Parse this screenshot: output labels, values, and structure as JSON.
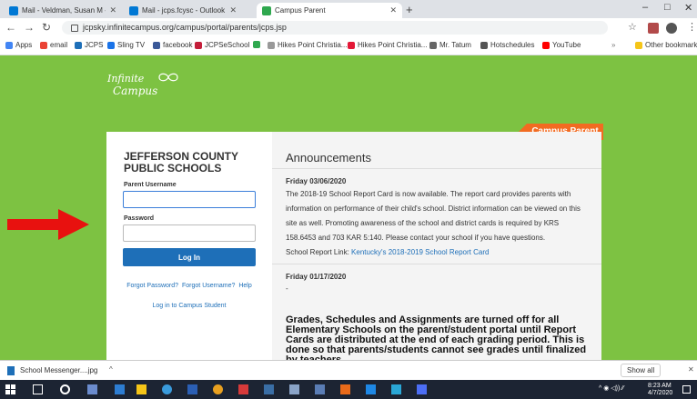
{
  "browser": {
    "tabs": [
      {
        "label": "Mail - Veldman, Susan M - Outlo",
        "color": "#0078d4"
      },
      {
        "label": "Mail - jcps.fcysc - Outlook",
        "color": "#0078d4"
      },
      {
        "label": "Campus Parent",
        "color": "#2fa84f"
      }
    ],
    "window_controls": [
      "–",
      "□",
      "✕"
    ],
    "url": "jcpsky.infinitecampus.org/campus/portal/parents/jcps.jsp",
    "bookmarks": [
      {
        "label": "Apps",
        "color": "#4285f4"
      },
      {
        "label": "email",
        "color": "#ea4335"
      },
      {
        "label": "JCPS",
        "color": "#1e6fb8"
      },
      {
        "label": "Sling TV",
        "color": "#1a73e8"
      },
      {
        "label": "facebook",
        "color": "#3b5998"
      },
      {
        "label": "JCPSeSchool",
        "color": "#c41e3a"
      },
      {
        "label": "",
        "color": "#2fa84f"
      },
      {
        "label": "Hikes Point Christia...",
        "color": "#999999"
      },
      {
        "label": "Hikes Point Christia...",
        "color": "#e31837"
      },
      {
        "label": "Mr. Tatum",
        "color": "#666666"
      },
      {
        "label": "Hotschedules",
        "color": "#555555"
      },
      {
        "label": "YouTube",
        "color": "#ff0000"
      }
    ],
    "other_bookmarks": "Other bookmarks"
  },
  "logo": {
    "line1": "Infinite",
    "line2": "Campus"
  },
  "badge": "Campus Parent",
  "login": {
    "school_name": "JEFFERSON COUNTY PUBLIC SCHOOLS",
    "username_label": "Parent Username",
    "username_value": "",
    "password_label": "Password",
    "password_value": "",
    "login_button": "Log In",
    "forgot_password": "Forgot Password?",
    "forgot_username": "Forgot Username?",
    "help": "Help",
    "student_link": "Log in to Campus Student"
  },
  "announcements": {
    "title": "Announcements",
    "items": [
      {
        "date": "Friday 03/06/2020",
        "body": "The 2018-19 School Report Card is now available. The report card provides parents with information on performance of their child's school. District information can be viewed on this site as well. Promoting awareness of the school and district cards is required by KRS 158.6453 and 703 KAR 5:140. Please contact your school if you have questions.",
        "link_prefix": "School Report Link: ",
        "link_text": "Kentucky's 2018-2019 School Report Card"
      },
      {
        "date": "Friday 01/17/2020",
        "body": "-",
        "highlight": "Grades, Schedules and Assignments are turned off for all Elementary Schools on the parent/student portal until Report Cards are distributed at the end of each grading period. This is done so that parents/students cannot see grades until  finalized by teachers."
      }
    ]
  },
  "download_bar": {
    "file": "School Messenger....jpg",
    "show_all": "Show all"
  },
  "taskbar": {
    "time": "8:23 AM",
    "date": "4/7/2020"
  },
  "colors": {
    "brand_green": "#7dc242",
    "campus_orange": "#f26b21",
    "button_blue": "#1e6fb8",
    "arrow_red": "#e8110f"
  }
}
